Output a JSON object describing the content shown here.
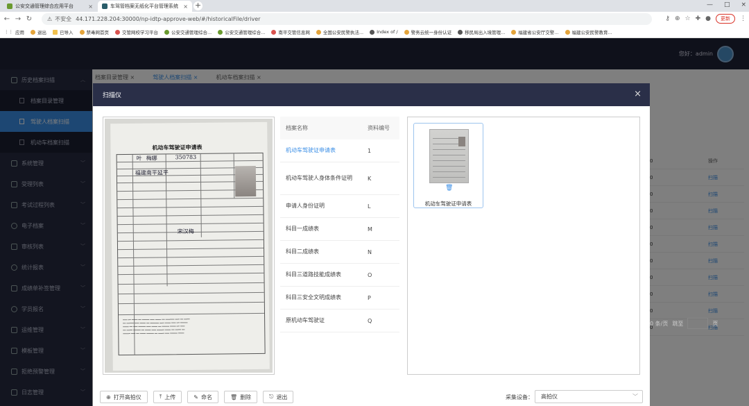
{
  "browser": {
    "tabs": [
      {
        "title": "公安交通管理综合应用平台",
        "color": "#6a9a2f"
      },
      {
        "title": "车驾管档案无纸化平台管理系统",
        "color": "#2a5d6a"
      }
    ],
    "address": {
      "insecure_label": "不安全",
      "url": "44.171.228.204:30000/np-idtp-approve-web/#/historicalFile/driver"
    },
    "update_label": "更新",
    "bookmarks": [
      "应用",
      "退出",
      "已导入",
      "禁毒网首页",
      "交管网校学习平台",
      "公安交通管理综合...",
      "公安交通管理综合...",
      "南平交管信息网",
      "全国公安民警执法...",
      "Index of /",
      "警务云统一身份认证",
      "移民局出入境管理...",
      "福建省公安厅交警...",
      "福建公安民警教育..."
    ]
  },
  "header": {
    "greeting": "您好：admin"
  },
  "sidebar": {
    "items": [
      {
        "label": "历史档案扫描",
        "expanded": true
      },
      {
        "label": "系统管理"
      },
      {
        "label": "受理列表"
      },
      {
        "label": "考试过程列表"
      },
      {
        "label": "电子档案"
      },
      {
        "label": "审核列表"
      },
      {
        "label": "统计报表"
      },
      {
        "label": "成绩单补签管理"
      },
      {
        "label": "学员报名"
      },
      {
        "label": "运维管理"
      },
      {
        "label": "模板管理"
      },
      {
        "label": "拒绝预警管理"
      },
      {
        "label": "日志管理"
      }
    ],
    "subitems": [
      {
        "label": "档案目录管理"
      },
      {
        "label": "驾驶人档案扫描",
        "active": true
      },
      {
        "label": "机动车档案扫描"
      }
    ]
  },
  "page_tabs": [
    {
      "label": "档案目录管理"
    },
    {
      "label": "驾驶人档案扫描",
      "active": true
    },
    {
      "label": "机动车档案扫描"
    }
  ],
  "background_table": {
    "header": "操作",
    "rows": [
      "扫描",
      "扫描",
      "扫描",
      "扫描",
      "扫描",
      "扫描",
      "扫描",
      "扫描",
      "扫描",
      "扫描"
    ],
    "pager": {
      "per_page": "0 条/页",
      "goto": "跳至",
      "page_suffix": "页"
    }
  },
  "modal": {
    "title": "扫描仪",
    "scan_title": "机动车驾驶证申请表",
    "scan_handwriting": [
      "叶",
      "梅娜",
      "350783",
      "福建南平延平",
      "宋汉梅"
    ],
    "table": {
      "columns": [
        "档案名称",
        "资料编号"
      ],
      "rows": [
        {
          "name": "机动车驾驶证申请表",
          "code": "1",
          "selected": true
        },
        {
          "name": "机动车驾驶人身体条件证明",
          "code": "K"
        },
        {
          "name": "申请人身份证明",
          "code": "L"
        },
        {
          "name": "科目一成绩表",
          "code": "M"
        },
        {
          "name": "科目二成绩表",
          "code": "N"
        },
        {
          "name": "科目三道路技能成绩表",
          "code": "O"
        },
        {
          "name": "科目三安全文明成绩表",
          "code": "P"
        },
        {
          "name": "原机动车驾驶证",
          "code": "Q"
        }
      ]
    },
    "preview": {
      "card_label": "机动车驾驶证申请表",
      "delete_icon": "trash-icon"
    },
    "buttons": [
      {
        "label": "打开高拍仪",
        "icon": "plus-circle-icon"
      },
      {
        "label": "上传",
        "icon": "upload-icon"
      },
      {
        "label": "命名",
        "icon": "edit-icon"
      },
      {
        "label": "删除",
        "icon": "trash-icon"
      },
      {
        "label": "退出",
        "icon": "exit-icon"
      }
    ],
    "device": {
      "label": "采集设备：",
      "value": "高拍仪"
    }
  },
  "colors": {
    "accent": "#3a8ee6",
    "sidebar": "#262b40",
    "header": "#1f2337"
  }
}
